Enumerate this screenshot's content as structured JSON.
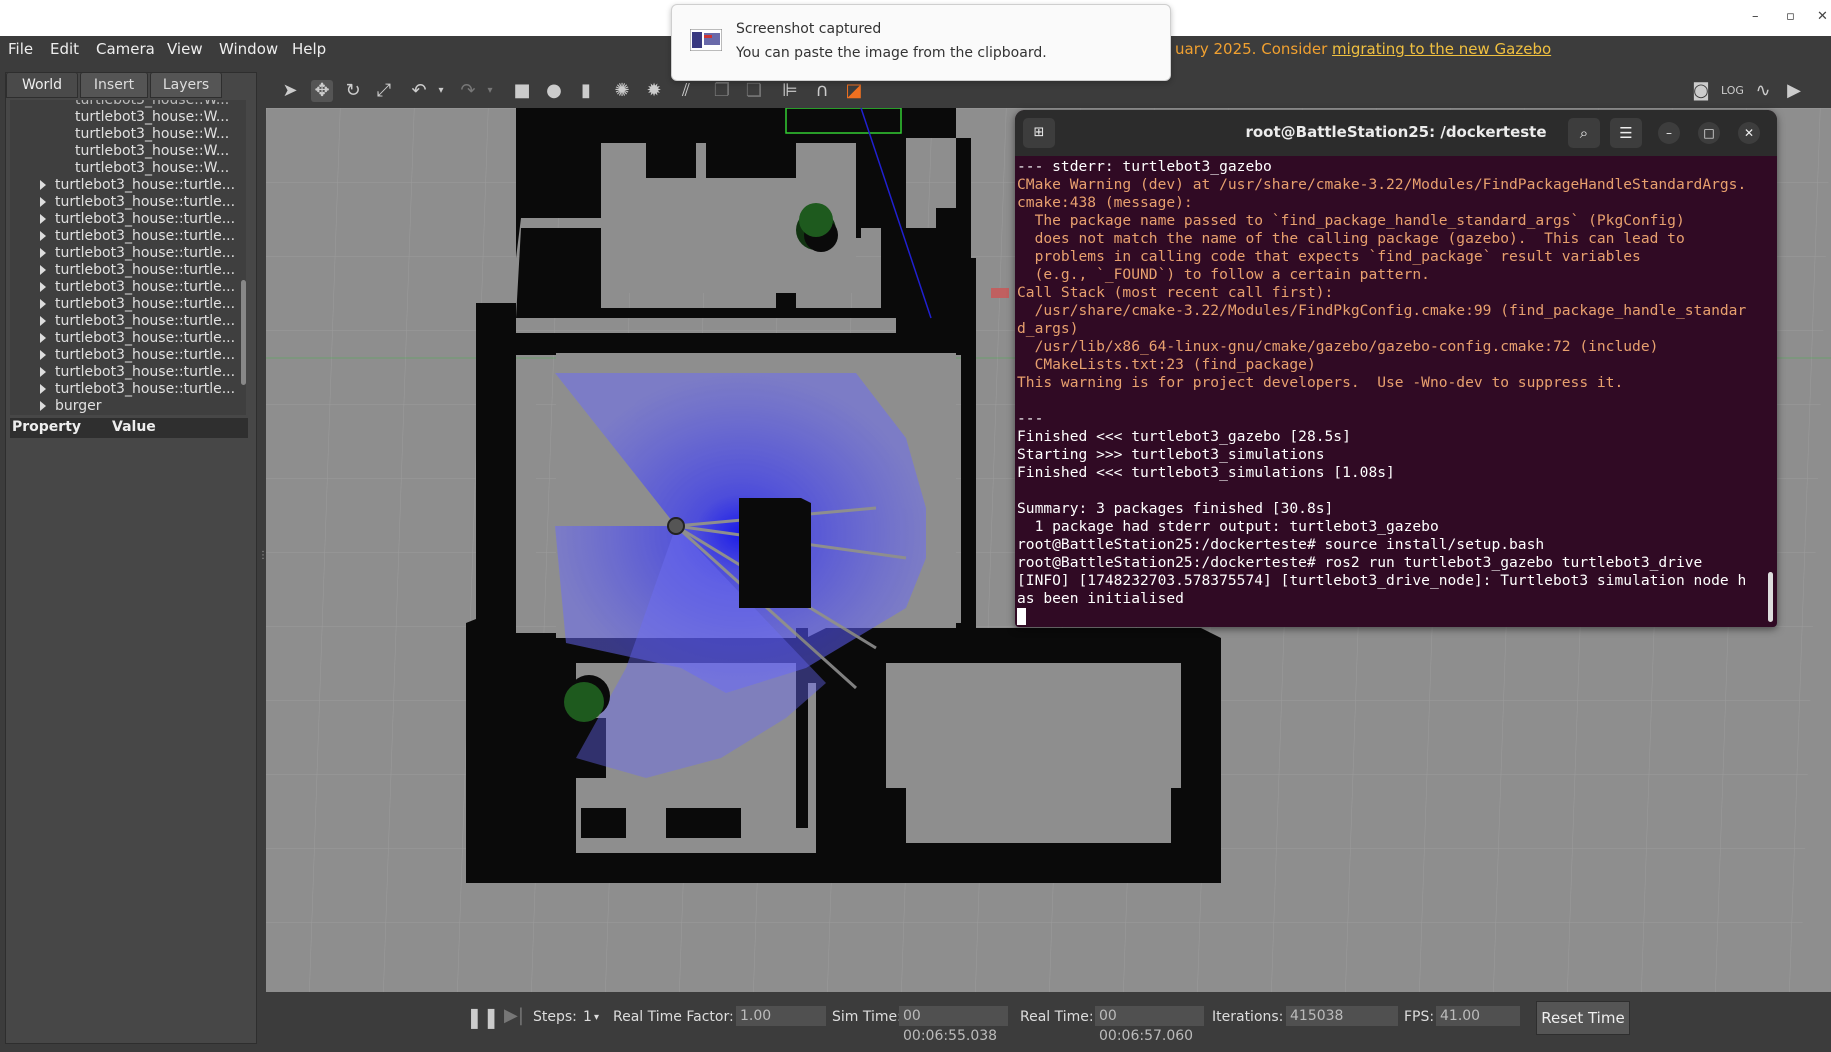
{
  "window": {
    "minimize": "–",
    "maximize": "▫",
    "close": "✕"
  },
  "menu": [
    "File",
    "Edit",
    "Camera",
    "View",
    "Window",
    "Help"
  ],
  "banner": {
    "text": "uary 2025. Consider ",
    "link": "migrating to the new Gazebo"
  },
  "notification": {
    "title": "Screenshot captured",
    "body": "You can paste the image from the clipboard."
  },
  "left_tabs": [
    "World",
    "Insert",
    "Layers"
  ],
  "tree": {
    "plain_items": [
      "turtlebot3_house::W...",
      "turtlebot3_house::W...",
      "turtlebot3_house::W...",
      "turtlebot3_house::W..."
    ],
    "expandable_items": [
      "turtlebot3_house::turtle...",
      "turtlebot3_house::turtle...",
      "turtlebot3_house::turtle...",
      "turtlebot3_house::turtle...",
      "turtlebot3_house::turtle...",
      "turtlebot3_house::turtle...",
      "turtlebot3_house::turtle...",
      "turtlebot3_house::turtle...",
      "turtlebot3_house::turtle...",
      "turtlebot3_house::turtle...",
      "turtlebot3_house::turtle...",
      "turtlebot3_house::turtle...",
      "turtlebot3_house::turtle..."
    ],
    "last_item": "burger"
  },
  "property_panel": {
    "col1": "Property",
    "col2": "Value"
  },
  "toolbar_icons": [
    "select-arrow-icon",
    "translate-icon",
    "rotate-icon",
    "scale-icon",
    "undo-icon",
    "undo-dropdown-icon",
    "redo-icon",
    "redo-dropdown-icon",
    "box-icon",
    "sphere-icon",
    "cylinder-icon",
    "point-light-icon",
    "spot-light-icon",
    "directional-light-icon",
    "copy-icon",
    "paste-icon",
    "align-icon",
    "snap-icon",
    "view-angle-icon",
    "screenshot-icon",
    "log-icon",
    "plot-icon",
    "video-record-icon"
  ],
  "terminal": {
    "title": "root@BattleStation25: /dockerteste",
    "lines": [
      {
        "text": "--- stderr: turtlebot3_gazebo",
        "warn": false
      },
      {
        "text": "CMake Warning (dev) at /usr/share/cmake-3.22/Modules/FindPackageHandleStandardArgs.",
        "warn": true
      },
      {
        "text": "cmake:438 (message):",
        "warn": true
      },
      {
        "text": "  The package name passed to `find_package_handle_standard_args` (PkgConfig)",
        "warn": true
      },
      {
        "text": "  does not match the name of the calling package (gazebo).  This can lead to",
        "warn": true
      },
      {
        "text": "  problems in calling code that expects `find_package` result variables",
        "warn": true
      },
      {
        "text": "  (e.g., `_FOUND`) to follow a certain pattern.",
        "warn": true
      },
      {
        "text": "Call Stack (most recent call first):",
        "warn": true
      },
      {
        "text": "  /usr/share/cmake-3.22/Modules/FindPkgConfig.cmake:99 (find_package_handle_standar",
        "warn": true
      },
      {
        "text": "d_args)",
        "warn": true
      },
      {
        "text": "  /usr/lib/x86_64-linux-gnu/cmake/gazebo/gazebo-config.cmake:72 (include)",
        "warn": true
      },
      {
        "text": "  CMakeLists.txt:23 (find_package)",
        "warn": true
      },
      {
        "text": "This warning is for project developers.  Use -Wno-dev to suppress it.",
        "warn": true
      },
      {
        "text": "",
        "warn": false
      },
      {
        "text": "---",
        "warn": false
      },
      {
        "text": "Finished <<< turtlebot3_gazebo [28.5s]",
        "warn": false
      },
      {
        "text": "Starting >>> turtlebot3_simulations",
        "warn": false
      },
      {
        "text": "Finished <<< turtlebot3_simulations [1.08s]",
        "warn": false
      },
      {
        "text": "",
        "warn": false
      },
      {
        "text": "Summary: 3 packages finished [30.8s]",
        "warn": false
      },
      {
        "text": "  1 package had stderr output: turtlebot3_gazebo",
        "warn": false
      },
      {
        "text": "root@BattleStation25:/dockerteste# source install/setup.bash",
        "warn": false
      },
      {
        "text": "root@BattleStation25:/dockerteste# ros2 run turtlebot3_gazebo turtlebot3_drive",
        "warn": false
      },
      {
        "text": "[INFO] [1748232703.578375574] [turtlebot3_drive_node]: Turtlebot3 simulation node h",
        "warn": false
      },
      {
        "text": "as been initialised",
        "warn": false
      }
    ]
  },
  "bottom": {
    "steps_label": "Steps:",
    "steps_value": "1",
    "rtf_label": "Real Time Factor:",
    "rtf_value": "1.00",
    "sim_time_label": "Sim Time:",
    "sim_time_value": "00 00:06:55.038",
    "real_time_label": "Real Time:",
    "real_time_value": "00 00:06:57.060",
    "iterations_label": "Iterations:",
    "iterations_value": "415038",
    "fps_label": "FPS:",
    "fps_value": "41.00",
    "reset_label": "Reset Time"
  },
  "colors": {
    "terminal_bg": "#300a24",
    "warning_text": "#e8a06e",
    "laser": "#3a3aff",
    "wall": "#0a0a0a",
    "ground": "#8e8e8e"
  }
}
